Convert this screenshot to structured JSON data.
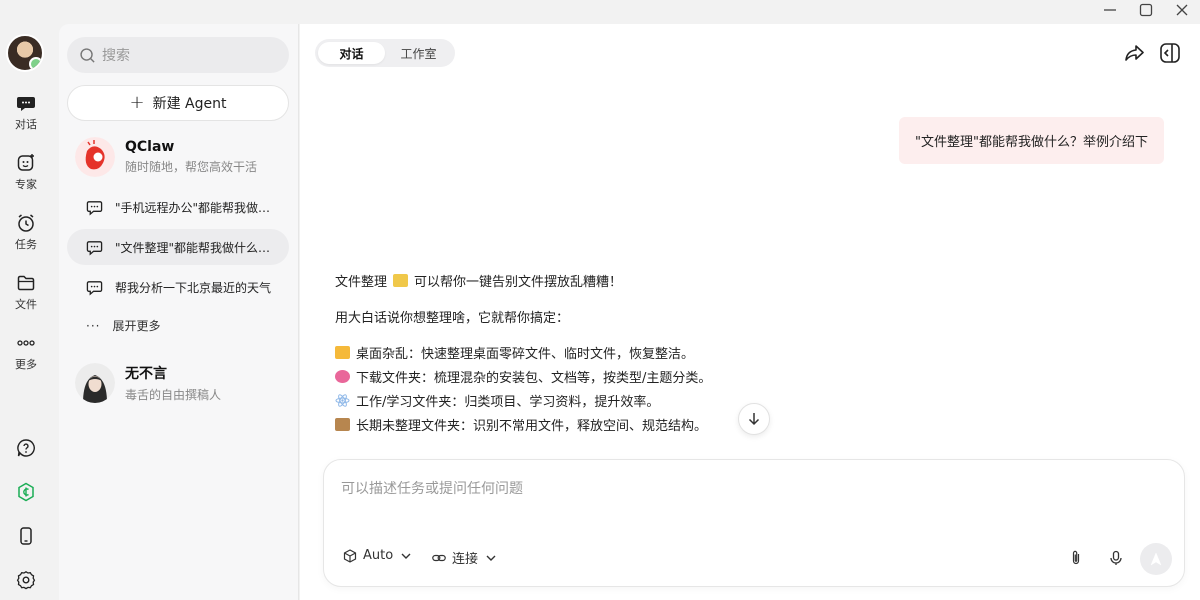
{
  "window": {
    "minimize_icon": "minimize-icon",
    "maximize_icon": "maximize-icon",
    "close_icon": "close-icon"
  },
  "rail": {
    "items": [
      {
        "label": "对话",
        "icon": "chat-icon"
      },
      {
        "label": "专家",
        "icon": "expert-icon"
      },
      {
        "label": "任务",
        "icon": "alarm-clock-icon"
      },
      {
        "label": "文件",
        "icon": "folder-icon"
      },
      {
        "label": "更多",
        "icon": "more-icon"
      }
    ],
    "bottom_icons": [
      "help-icon",
      "credits-icon",
      "phone-icon",
      "settings-icon"
    ]
  },
  "sidebar": {
    "search_placeholder": "搜索",
    "new_agent_label": "新建 Agent",
    "agents": [
      {
        "name": "QClaw",
        "desc": "随时随地，帮您高效干活"
      },
      {
        "name": "无不言",
        "desc": "毒舌的自由撰稿人"
      }
    ],
    "conversations": [
      {
        "title": "\"手机远程办公\"都能帮我做什么？"
      },
      {
        "title": "\"文件整理\"都能帮我做什么？举例介绍下"
      },
      {
        "title": "帮我分析一下北京最近的天气"
      }
    ],
    "expand_more": "展开更多"
  },
  "main": {
    "tabs": [
      "对话",
      "工作室"
    ],
    "active_tab": "对话",
    "user_message": "\"文件整理\"都能帮我做什么？举例介绍下",
    "reply": {
      "intro_prefix": "文件整理",
      "intro_suffix": "可以帮你一键告别文件摆放乱糟糟！",
      "line2": "用大白话说你想整理啥，它就帮你搞定：",
      "bullets": [
        {
          "text": "桌面杂乱：快速整理桌面零碎文件、临时文件，恢复整洁。",
          "color": "#f5b93a"
        },
        {
          "text": "下载文件夹：梳理混杂的安装包、文档等，按类型/主题分类。",
          "color": "#e9679a"
        },
        {
          "text": "工作/学习文件夹：归类项目、学习资料，提升效率。",
          "color": "#8fb8e8"
        },
        {
          "text": "长期未整理文件夹：识别不常用文件，释放空间、规范结构。",
          "color": "#b7864f"
        }
      ]
    },
    "composer": {
      "placeholder": "可以描述任务或提问任何问题",
      "model_label": "Auto",
      "connect_label": "连接"
    }
  },
  "colors": {
    "accent_green": "#1aad55",
    "bubble_bg": "#fdeeee"
  }
}
